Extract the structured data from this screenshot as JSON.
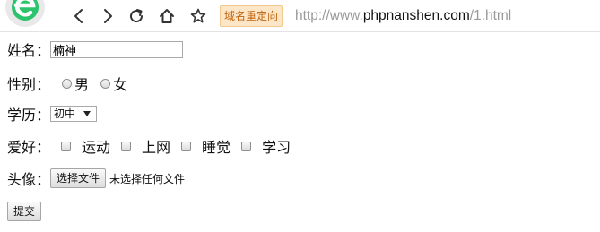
{
  "browser": {
    "redirect_badge": "域名重定向",
    "url_scheme": "http://www.",
    "url_host": "phpnanshen.com",
    "url_path": "/1.html"
  },
  "form": {
    "name_label": "姓名：",
    "name_value": "楠神",
    "gender_label": "性别：",
    "gender_options": [
      "男",
      "女"
    ],
    "education_label": "学历：",
    "education_selected": "初中",
    "hobbies_label": "爱好：",
    "hobbies": [
      "运动",
      "上网",
      "睡觉",
      "学习"
    ],
    "avatar_label": "头像：",
    "file_button": "选择文件",
    "file_status": "未选择任何文件",
    "submit": "提交"
  }
}
